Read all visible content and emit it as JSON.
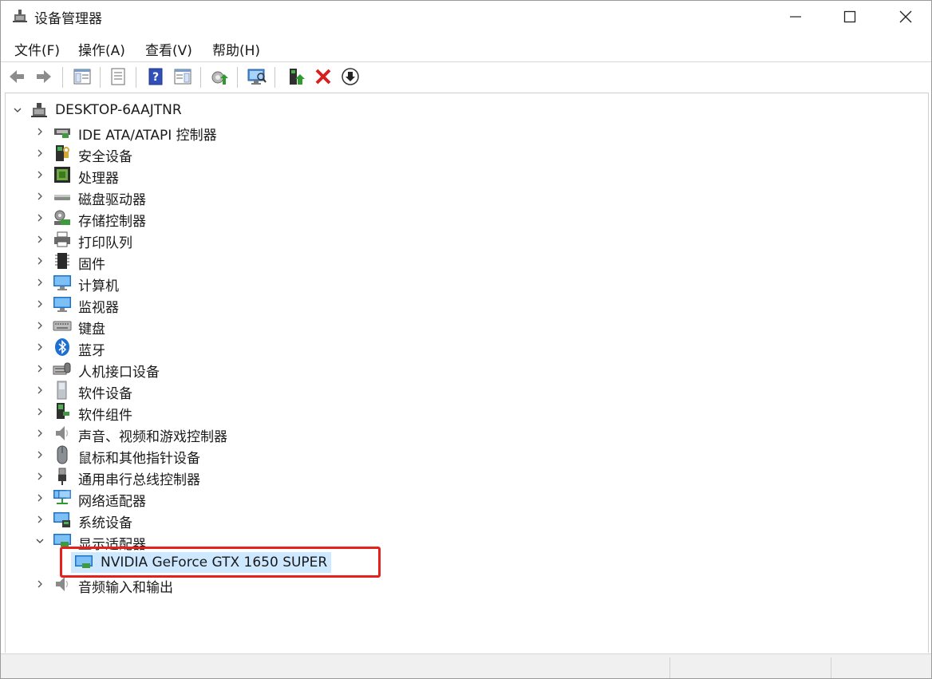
{
  "window": {
    "title": "设备管理器"
  },
  "menu": [
    "文件(F)",
    "操作(A)",
    "查看(V)",
    "帮助(H)"
  ],
  "toolbar": {
    "buttons": [
      "back-icon",
      "forward-icon",
      "show-hide-tree-icon",
      "properties-icon",
      "help-icon",
      "action-pane-icon",
      "update-driver-icon",
      "scan-hardware-icon",
      "enable-device-icon",
      "uninstall-icon",
      "disable-device-icon"
    ]
  },
  "tree": {
    "root": "DESKTOP-6AAJTNR",
    "categories": [
      "IDE ATA/ATAPI 控制器",
      "安全设备",
      "处理器",
      "磁盘驱动器",
      "存储控制器",
      "打印队列",
      "固件",
      "计算机",
      "监视器",
      "键盘",
      "蓝牙",
      "人机接口设备",
      "软件设备",
      "软件组件",
      "声音、视频和游戏控制器",
      "鼠标和其他指针设备",
      "通用串行总线控制器",
      "网络适配器",
      "系统设备",
      "显示适配器",
      "音频输入和输出"
    ],
    "expanded_category": "显示适配器",
    "selected_device": "NVIDIA GeForce GTX 1650 SUPER"
  },
  "colors": {
    "selection": "#cde8ff",
    "highlight_box": "#e8201c",
    "uninstall": "#d81e1e"
  }
}
